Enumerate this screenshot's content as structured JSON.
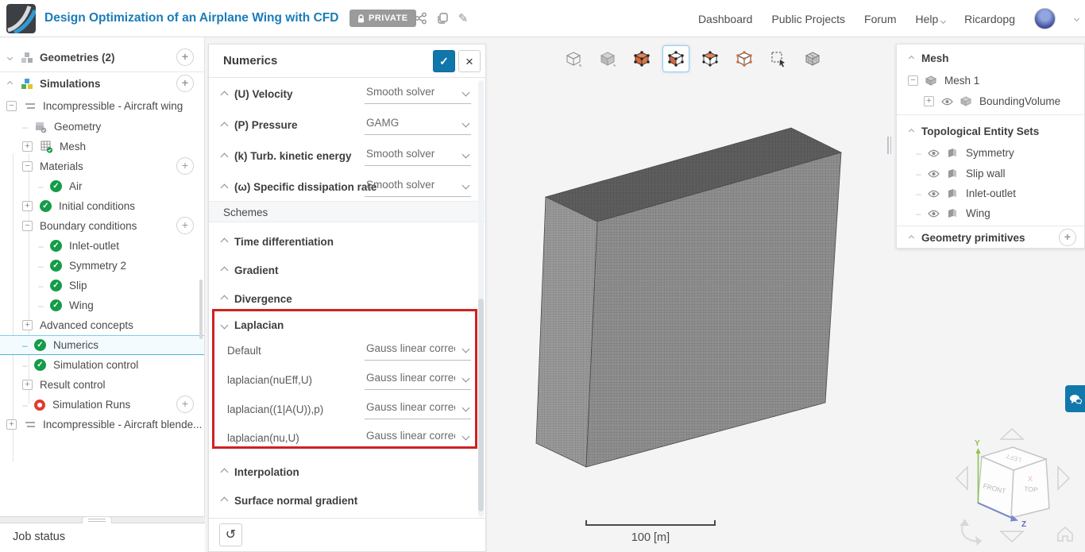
{
  "icons": {
    "plus": "+",
    "minus": "−",
    "check": "✓",
    "close": "×",
    "undo": "↺"
  },
  "header": {
    "title": "Design Optimization of an Airplane Wing with CFD",
    "privacy_badge": "PRIVATE",
    "nav": {
      "dashboard": "Dashboard",
      "public_projects": "Public Projects",
      "forum": "Forum",
      "help": "Help",
      "username": "Ricardopg"
    }
  },
  "sidebar": {
    "rows": [
      {
        "label": "Geometries (2)"
      },
      {
        "label": "Simulations"
      },
      {
        "label": "Incompressible - Aircraft wing"
      },
      {
        "label": "Geometry"
      },
      {
        "label": "Mesh"
      },
      {
        "label": "Materials"
      },
      {
        "label": "Air"
      },
      {
        "label": "Initial conditions"
      },
      {
        "label": "Boundary conditions"
      },
      {
        "label": "Inlet-outlet"
      },
      {
        "label": "Symmetry 2"
      },
      {
        "label": "Slip"
      },
      {
        "label": "Wing"
      },
      {
        "label": "Advanced concepts"
      },
      {
        "label": "Numerics"
      },
      {
        "label": "Simulation control"
      },
      {
        "label": "Result control"
      },
      {
        "label": "Simulation Runs"
      },
      {
        "label": "Incompressible - Aircraft blende..."
      }
    ],
    "job_status": "Job status"
  },
  "numerics": {
    "title": "Numerics",
    "solver_fields": [
      {
        "label": "(U) Velocity",
        "value": "Smooth solver"
      },
      {
        "label": "(P) Pressure",
        "value": "GAMG"
      },
      {
        "label": "(k) Turb. kinetic energy",
        "value": "Smooth solver"
      },
      {
        "label": "(ω) Specific dissipation rate",
        "value": "Smooth solver"
      }
    ],
    "schemes_header": "Schemes",
    "sections_before": [
      "Time differentiation",
      "Gradient",
      "Divergence"
    ],
    "laplacian": {
      "title": "Laplacian",
      "fields": [
        {
          "label": "Default",
          "value": "Gauss linear correc"
        },
        {
          "label": "laplacian(nuEff,U)",
          "value": "Gauss linear correc"
        },
        {
          "label": "laplacian((1|A(U)),p)",
          "value": "Gauss linear correc"
        },
        {
          "label": "laplacian(nu,U)",
          "value": "Gauss linear correc"
        }
      ]
    },
    "sections_after": [
      "Interpolation",
      "Surface normal gradient"
    ]
  },
  "viewport": {
    "scale_label": "100 [m]",
    "nav_cube": {
      "front": "FRONT",
      "top": "TOP",
      "left": "LEFT",
      "axis_x": "X",
      "axis_y": "Y",
      "axis_z": "Z"
    }
  },
  "right_panel": {
    "mesh_header": "Mesh",
    "mesh_items": [
      {
        "label": "Mesh 1"
      },
      {
        "label": "BoundingVolume"
      }
    ],
    "topo_header": "Topological Entity Sets",
    "topo_items": [
      {
        "label": "Symmetry"
      },
      {
        "label": "Slip wall"
      },
      {
        "label": "Inlet-outlet"
      },
      {
        "label": "Wing"
      }
    ],
    "geometry_primitives_header": "Geometry primitives"
  }
}
